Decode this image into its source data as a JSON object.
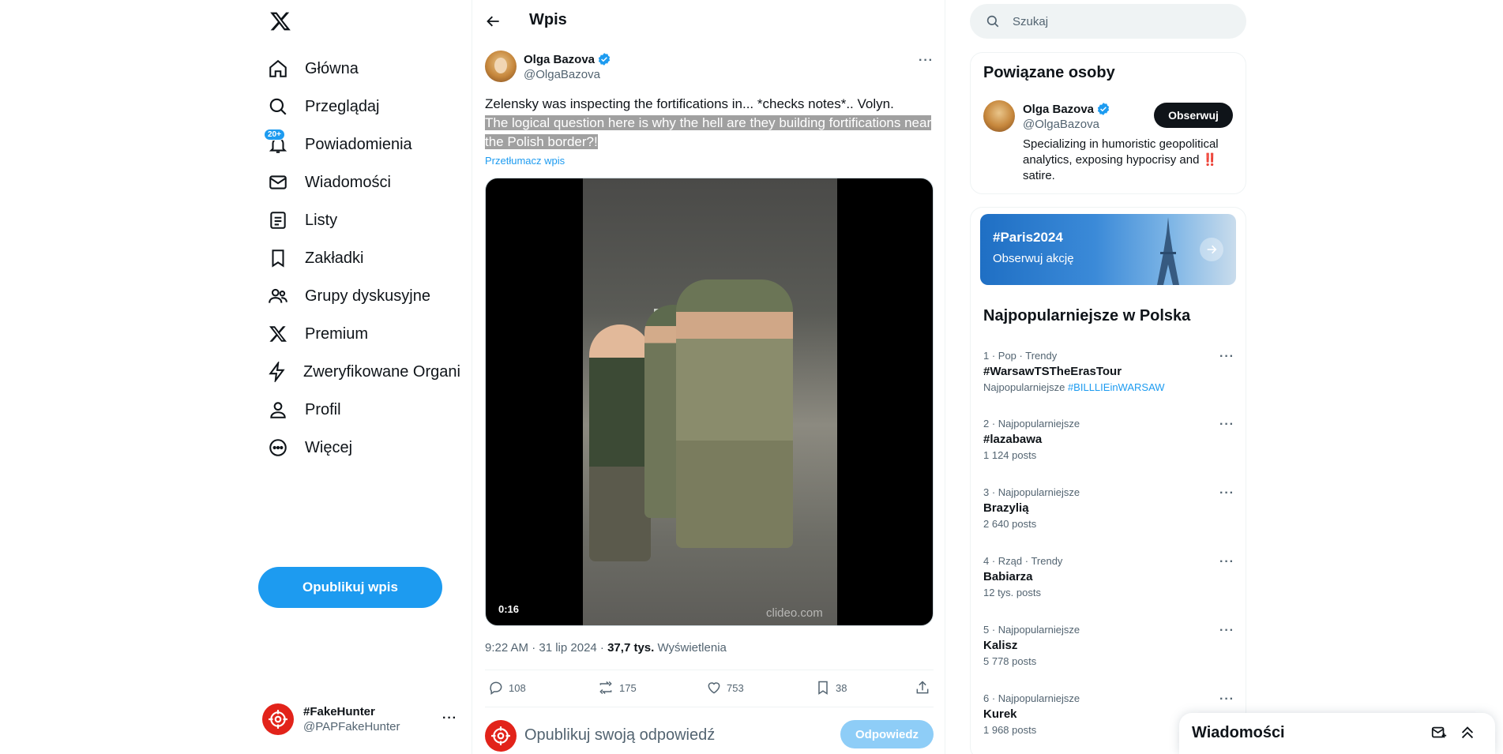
{
  "nav": {
    "items": [
      {
        "label": "Główna",
        "icon": "home-icon"
      },
      {
        "label": "Przeglądaj",
        "icon": "search-icon"
      },
      {
        "label": "Powiadomienia",
        "icon": "bell-icon",
        "badge": "20+"
      },
      {
        "label": "Wiadomości",
        "icon": "mail-icon"
      },
      {
        "label": "Listy",
        "icon": "list-icon"
      },
      {
        "label": "Zakładki",
        "icon": "bookmark-icon"
      },
      {
        "label": "Grupy dyskusyjne",
        "icon": "people-icon"
      },
      {
        "label": "Premium",
        "icon": "x-logo-icon"
      },
      {
        "label": "Zweryfikowane Organizacje",
        "icon": "lightning-icon"
      },
      {
        "label": "Profil",
        "icon": "person-icon"
      },
      {
        "label": "Więcej",
        "icon": "more-circle-icon"
      }
    ],
    "post_button": "Opublikuj wpis",
    "account": {
      "name": "#FakeHunter",
      "handle": "@PAPFakeHunter"
    }
  },
  "main": {
    "title": "Wpis",
    "author": {
      "name": "Olga Bazova",
      "handle": "@OlgaBazova",
      "verified": true
    },
    "text_plain": "Zelensky was inspecting the fortifications in... *checks notes*.. Volyn.",
    "text_highlighted": "The logical question here is why the hell are they building fortifications near the Polish border?!",
    "translate": "Przetłumacz wpis",
    "video": {
      "duration": "0:16",
      "watermark": "clideo.com"
    },
    "meta": {
      "time": "9:22 AM · 31 lip 2024 · ",
      "views_count": "37,7 tys.",
      "views_label": " Wyświetlenia"
    },
    "actions": {
      "replies": "108",
      "reposts": "175",
      "likes": "753",
      "bookmarks": "38"
    },
    "reply": {
      "placeholder": "Opublikuj swoją odpowiedź",
      "button": "Odpowiedz"
    }
  },
  "sidebar": {
    "search_placeholder": "Szukaj",
    "related": {
      "title": "Powiązane osoby",
      "name": "Olga Bazova",
      "handle": "@OlgaBazova",
      "follow": "Obserwuj",
      "bio": "Specializing in humoristic geopolitical analytics, exposing hypocrisy and ‼️ satire."
    },
    "promo": {
      "title": "#Paris2024",
      "subtitle": "Obserwuj akcję"
    },
    "trends_title": "Najpopularniejsze w Polska",
    "trends": [
      {
        "meta": "1 · Pop · Trendy",
        "name": "#WarsawTSTheErasTour",
        "count": "Najpopularniejsze ",
        "link": "#BILLLIEinWARSAW"
      },
      {
        "meta": "2 · Najpopularniejsze",
        "name": "#lazabawa",
        "count": "1 124 posts"
      },
      {
        "meta": "3 · Najpopularniejsze",
        "name": "Brazylią",
        "count": "2 640 posts"
      },
      {
        "meta": "4 · Rząd · Trendy",
        "name": "Babiarza",
        "count": "12 tys. posts"
      },
      {
        "meta": "5 · Najpopularniejsze",
        "name": "Kalisz",
        "count": "5 778 posts"
      },
      {
        "meta": "6 · Najpopularniejsze",
        "name": "Kurek",
        "count": "1 968 posts"
      }
    ]
  },
  "drawer": {
    "title": "Wiadomości"
  },
  "colors": {
    "accent": "#1d9bf0",
    "text": "#0f1419",
    "muted": "#536471",
    "border": "#eff3f4"
  }
}
